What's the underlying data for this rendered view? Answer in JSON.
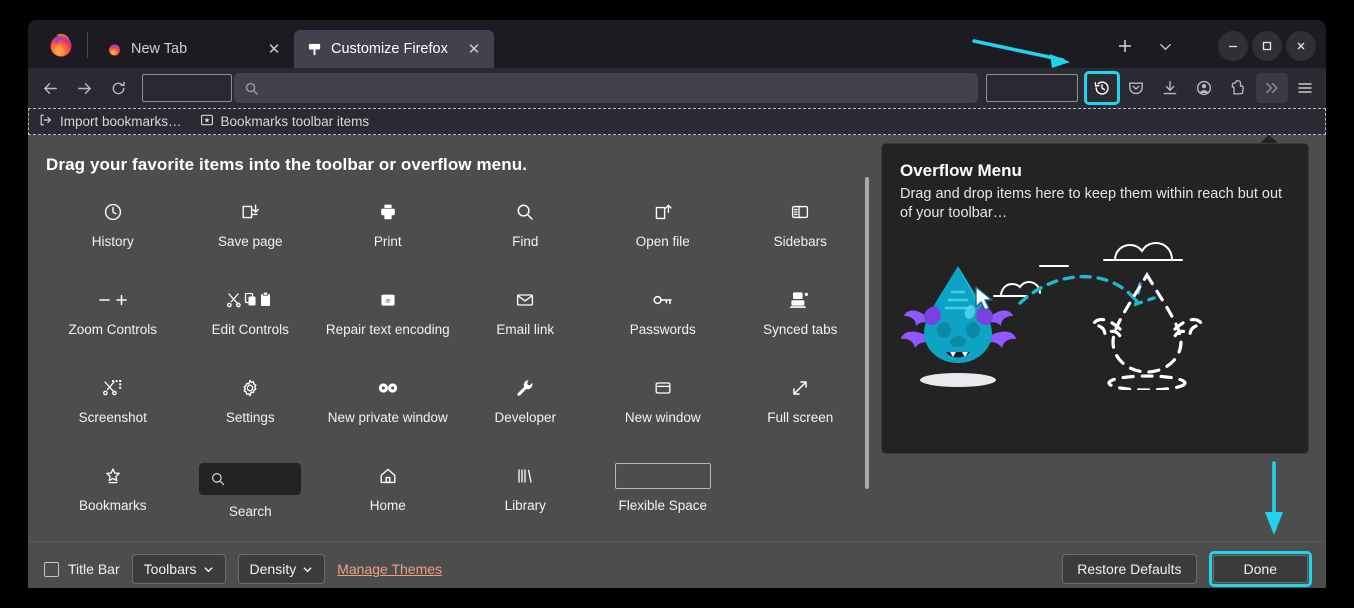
{
  "window": {
    "controls": {
      "minimize": "–",
      "maximize": "□",
      "close": "✕"
    },
    "new_tab_label": "+",
    "list_all_tabs_label": "⌄"
  },
  "tabs": [
    {
      "title": "New Tab",
      "icon": "firefox-icon",
      "active": false,
      "close": "✕"
    },
    {
      "title": "Customize Firefox",
      "icon": "customize-icon",
      "active": true,
      "close": "✕"
    }
  ],
  "navbar": {
    "back": "back-icon",
    "forward": "forward-icon",
    "reload": "reload-icon",
    "url_placeholder": "",
    "url_value": "",
    "icons": [
      "history-icon",
      "pocket-icon",
      "downloads-icon",
      "account-icon",
      "extensions-icon",
      "overflow-icon"
    ],
    "menu": "hamburger-icon",
    "highlighted_icon": "history-icon",
    "highlight_color": "#22d3ee"
  },
  "bookmarks_bar": {
    "items": [
      {
        "label": "Import bookmarks…",
        "icon": "import-icon"
      },
      {
        "label": "Bookmarks toolbar items",
        "icon": "bookmarks-folder-icon"
      }
    ]
  },
  "customize": {
    "heading": "Drag your favorite items into the toolbar or overflow menu.",
    "palette": [
      {
        "label": "History",
        "icon": "clock-icon",
        "type": "icon"
      },
      {
        "label": "Save page",
        "icon": "save-page-icon",
        "type": "icon"
      },
      {
        "label": "Print",
        "icon": "print-icon",
        "type": "icon"
      },
      {
        "label": "Find",
        "icon": "search-icon",
        "type": "icon"
      },
      {
        "label": "Open file",
        "icon": "open-file-icon",
        "type": "icon"
      },
      {
        "label": "Sidebars",
        "icon": "sidebars-icon",
        "type": "icon"
      },
      {
        "label": "Zoom Controls",
        "icon": "zoom-controls-icon",
        "type": "icon"
      },
      {
        "label": "Edit Controls",
        "icon": "edit-controls-icon",
        "type": "icon"
      },
      {
        "label": "Repair text encoding",
        "icon": "repair-text-encoding-icon",
        "type": "icon"
      },
      {
        "label": "Email link",
        "icon": "email-icon",
        "type": "icon"
      },
      {
        "label": "Passwords",
        "icon": "key-icon",
        "type": "icon"
      },
      {
        "label": "Synced tabs",
        "icon": "synced-tabs-icon",
        "type": "icon"
      },
      {
        "label": "Screenshot",
        "icon": "screenshot-icon",
        "type": "icon"
      },
      {
        "label": "Settings",
        "icon": "gear-icon",
        "type": "icon"
      },
      {
        "label": "New private window",
        "icon": "private-window-icon",
        "type": "icon"
      },
      {
        "label": "Developer",
        "icon": "wrench-icon",
        "type": "icon"
      },
      {
        "label": "New window",
        "icon": "new-window-icon",
        "type": "icon"
      },
      {
        "label": "Full screen",
        "icon": "fullscreen-icon",
        "type": "icon"
      },
      {
        "label": "Bookmarks",
        "icon": "bookmark-star-icon",
        "type": "icon"
      },
      {
        "label": "Search",
        "icon": "search-icon",
        "type": "searchbox"
      },
      {
        "label": "Home",
        "icon": "home-icon",
        "type": "icon"
      },
      {
        "label": "Library",
        "icon": "library-icon",
        "type": "icon"
      },
      {
        "label": "Flexible Space",
        "icon": "flexible-space-icon",
        "type": "flexspace"
      }
    ]
  },
  "overflow_panel": {
    "title": "Overflow Menu",
    "description": "Drag and drop items here to keep them within reach but out of your toolbar…",
    "illustration": "drag-drop-creature-illustration"
  },
  "footer": {
    "title_bar_label": "Title Bar",
    "title_bar_checked": false,
    "toolbars_label": "Toolbars",
    "density_label": "Density",
    "manage_themes_label": "Manage Themes",
    "restore_defaults_label": "Restore Defaults",
    "done_label": "Done",
    "done_highlight_color": "#22d3ee"
  },
  "annotations": {
    "arrow_to_history": "cyan-arrow-pointing-to-history-button",
    "arrow_to_done": "cyan-arrow-pointing-to-done-button",
    "color": "#22d3ee"
  }
}
